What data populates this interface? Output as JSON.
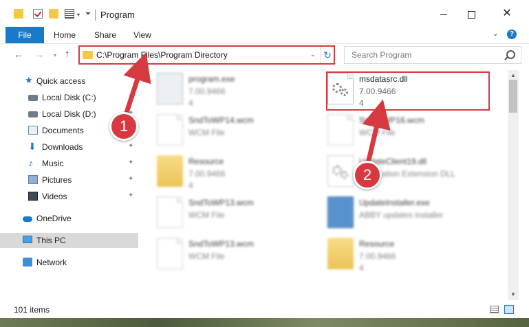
{
  "window": {
    "title": "Program",
    "controls": {
      "minimize": "",
      "maximize": "",
      "close": "✕"
    }
  },
  "ribbon": {
    "tabs": [
      "File",
      "Home",
      "Share",
      "View"
    ],
    "help": "?",
    "expand": "⌄"
  },
  "nav": {
    "back": "←",
    "forward": "→",
    "recent": "▾",
    "up": "↑",
    "address": "C:\\Program Files\\Program Directory",
    "address_dropdown": "⌄",
    "refresh": "↻",
    "search_placeholder": "Search Program"
  },
  "sidebar": {
    "items": [
      {
        "label": "Quick access",
        "icon": "star-icon",
        "pinned": false
      },
      {
        "label": "Local Disk (C:)",
        "icon": "drive-icon",
        "pinned": true
      },
      {
        "label": "Local Disk (D:)",
        "icon": "drive-icon",
        "pinned": true
      },
      {
        "label": "Documents",
        "icon": "documents-icon",
        "pinned": true
      },
      {
        "label": "Downloads",
        "icon": "download-icon",
        "pinned": true
      },
      {
        "label": "Music",
        "icon": "music-icon",
        "pinned": true
      },
      {
        "label": "Pictures",
        "icon": "pictures-icon",
        "pinned": true
      },
      {
        "label": "Videos",
        "icon": "videos-icon",
        "pinned": true
      },
      {
        "label": "OneDrive",
        "icon": "cloud-icon",
        "pinned": false
      },
      {
        "label": "This PC",
        "icon": "computer-icon",
        "pinned": false,
        "selected": true
      },
      {
        "label": "Network",
        "icon": "network-icon",
        "pinned": false
      }
    ],
    "pin_glyph": "📌"
  },
  "files": [
    {
      "name": "program.exe",
      "desc": "7.00.9466",
      "size": "4",
      "type": "exe"
    },
    {
      "name": "msdatasrc.dll",
      "desc": "7.00.9466",
      "size": "4",
      "type": "dll",
      "highlighted": true
    },
    {
      "name": "SndToWP14.wcm",
      "desc": "WCM File",
      "size": "",
      "type": "doc"
    },
    {
      "name": "SndToWP16.wcm",
      "desc": "WCM File",
      "size": "",
      "type": "doc"
    },
    {
      "name": "Resource",
      "desc": "7.00.9466",
      "size": "4",
      "type": "folder"
    },
    {
      "name": "UpdateClient19.dll",
      "desc": "Application Extension DLL",
      "size": "",
      "type": "dll"
    },
    {
      "name": "SndToWP13.wcm",
      "desc": "WCM File",
      "size": "",
      "type": "doc"
    },
    {
      "name": "UpdateInstaller.exe",
      "desc": "ABBY updates installer",
      "size": "",
      "type": "installer"
    },
    {
      "name": "SndToWP13.wcm",
      "desc": "WCM File",
      "size": "",
      "type": "doc"
    },
    {
      "name": "Resource",
      "desc": "7.00.9466",
      "size": "4",
      "type": "folder"
    }
  ],
  "status": {
    "item_count": "101 items"
  },
  "annotations": {
    "step1": "1",
    "step2": "2",
    "highlight_color": "#d9383e",
    "badge_color": "#d63a40"
  },
  "colors": {
    "accent": "#1979ca",
    "folder": "#f5c747"
  }
}
